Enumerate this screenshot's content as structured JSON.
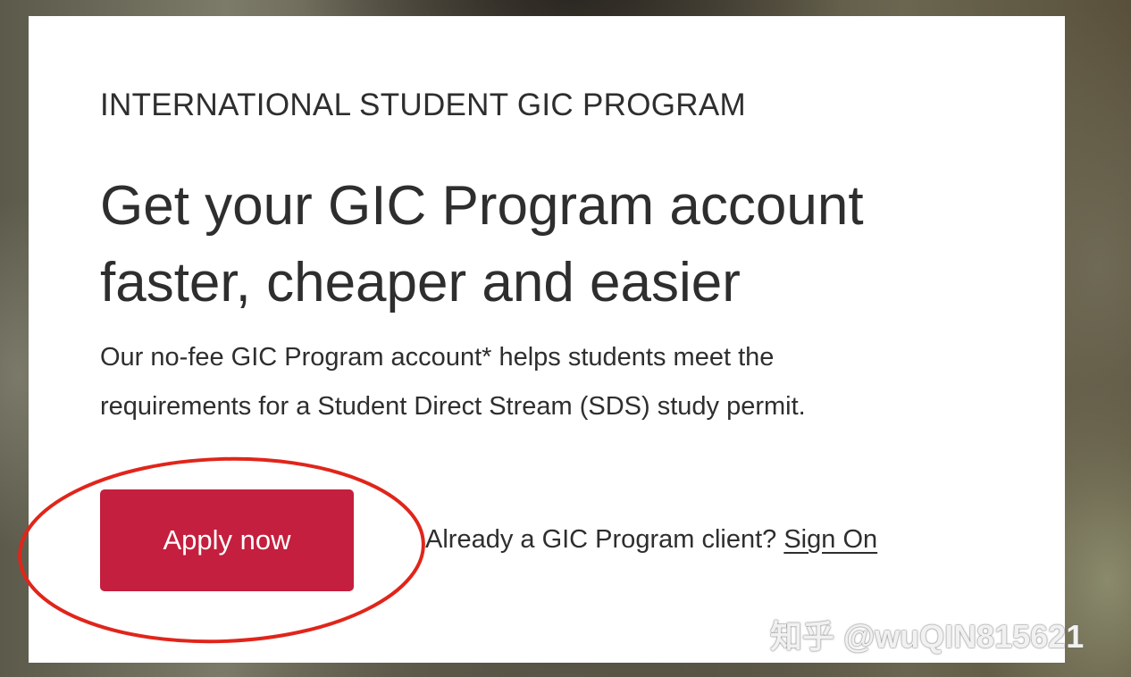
{
  "hero": {
    "eyebrow": "INTERNATIONAL STUDENT GIC PROGRAM",
    "headline_line1": "Get your GIC Program account",
    "headline_line2": "faster, cheaper and easier",
    "description_line1": "Our no-fee GIC Program account* helps students meet the",
    "description_line2": "requirements for a Student Direct Stream (SDS) study permit."
  },
  "actions": {
    "apply_label": "Apply now",
    "signon_prompt": "Already a GIC Program client?",
    "signon_link": "Sign On"
  },
  "watermark": {
    "text": "知乎 @wuQIN815621"
  },
  "colors": {
    "apply_button": "#c41f3e",
    "annotation_circle": "#e0251b",
    "text": "#2e2e2e",
    "card": "#ffffff"
  }
}
